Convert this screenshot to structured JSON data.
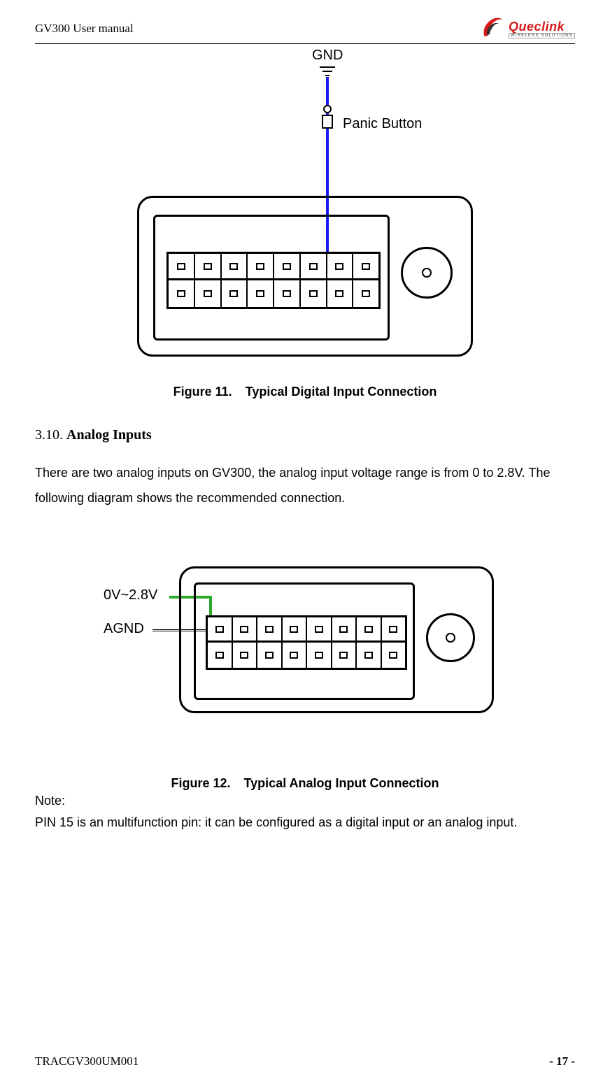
{
  "header": {
    "title": "GV300 User manual",
    "logo_name": "Queclink",
    "logo_sub": "WIRELESS SOLUTIONS"
  },
  "footer": {
    "doc_id": "TRACGV300UM001",
    "page": "- 17 -"
  },
  "figure11": {
    "gnd": "GND",
    "panic": "Panic Button",
    "caption_prefix": "Figure 11.",
    "caption_title": "Typical Digital Input Connection"
  },
  "section": {
    "number": "3.10. ",
    "title": "Analog Inputs"
  },
  "body": "There are two analog inputs on GV300, the analog input voltage range is from 0 to 2.8V. The following diagram shows the recommended connection.",
  "figure12": {
    "voltage": "0V~2.8V",
    "agnd": "AGND",
    "caption_prefix": "Figure 12.",
    "caption_title": "Typical Analog Input Connection"
  },
  "note": {
    "label": "Note:",
    "text": "PIN 15 is an multifunction pin: it can be configured as a digital input or an analog input."
  }
}
